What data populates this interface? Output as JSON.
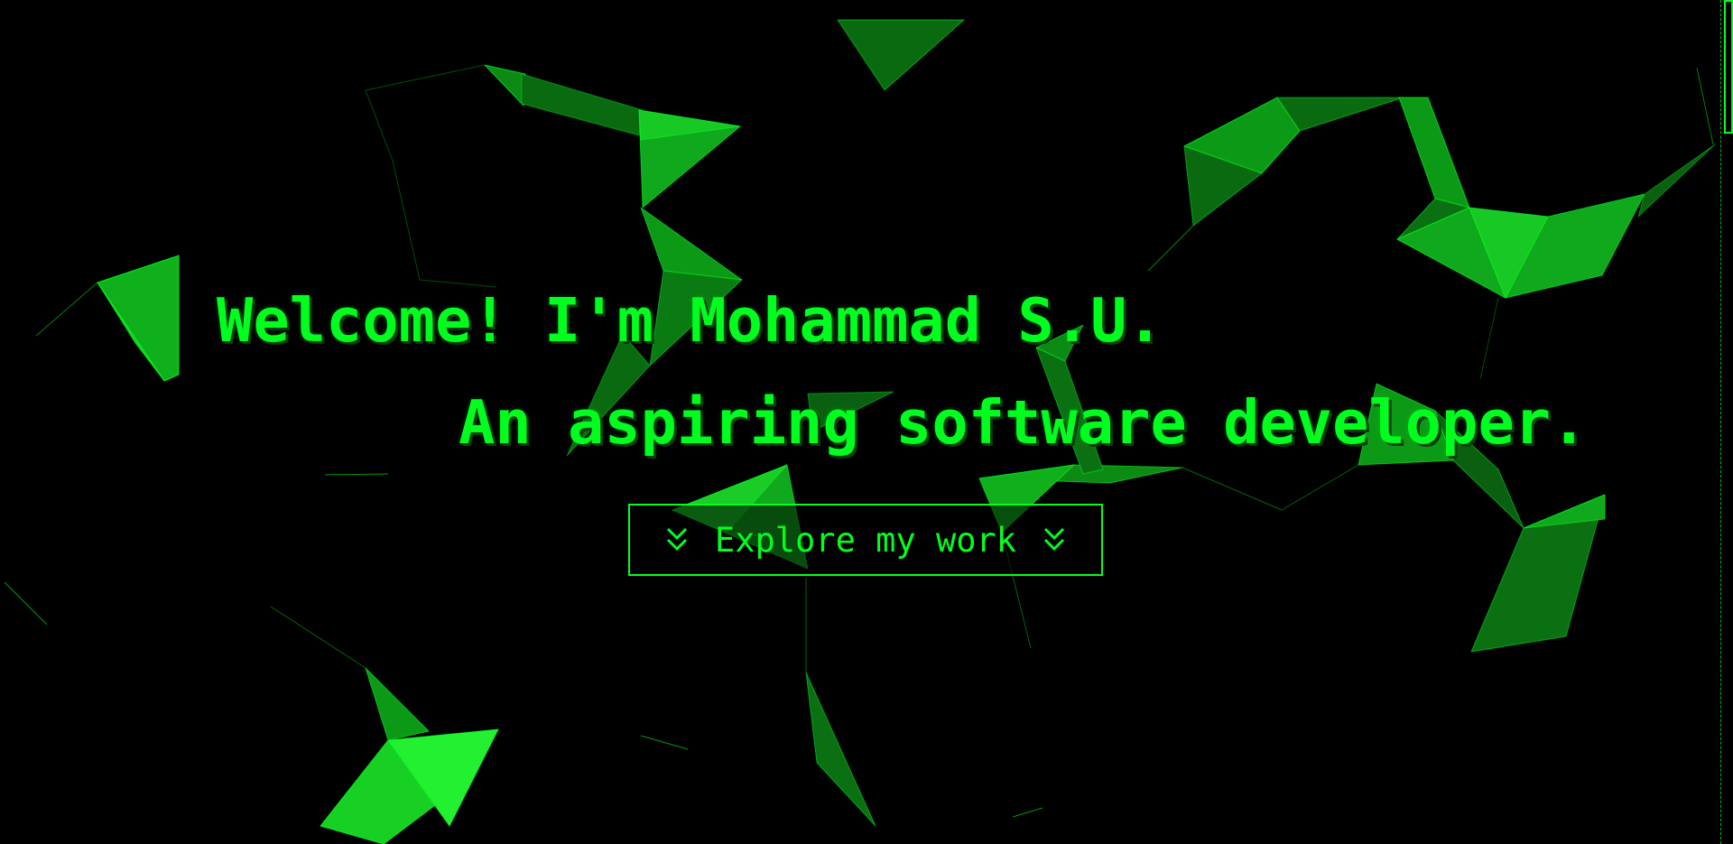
{
  "hero": {
    "greeting": "Welcome! I'm Mohammad S.U.",
    "tagline": "An aspiring software developer.",
    "cta_label": "Explore my work",
    "cta_icon": "double-chevron-down-icon"
  },
  "theme": {
    "accent": "#00ff1e",
    "background": "#000000",
    "shadow": "#063d0b"
  }
}
